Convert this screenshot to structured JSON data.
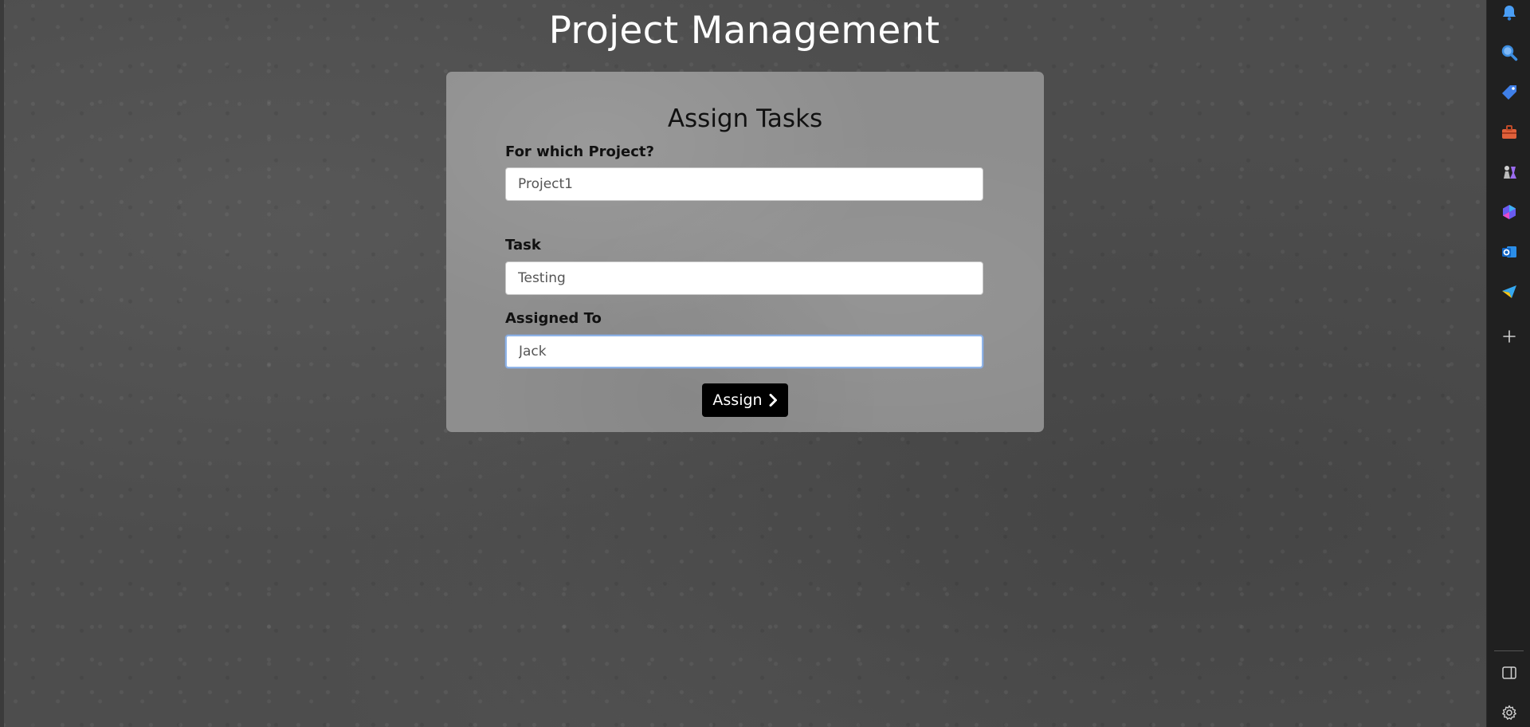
{
  "page": {
    "title": "Project Management"
  },
  "form": {
    "heading": "Assign Tasks",
    "project_label": "For which Project?",
    "project_value": "Project1",
    "task_label": "Task",
    "task_value": "Testing",
    "assigned_label": "Assigned To",
    "assigned_value": "Jack",
    "submit_label": "Assign",
    "submit_icon": "chevron-right-icon"
  },
  "sidebar": {
    "icons": [
      "bell-icon",
      "search-icon",
      "tag-icon",
      "toolbox-icon",
      "chess-icon",
      "copilot-icon",
      "outlook-icon",
      "send-icon",
      "add-icon"
    ],
    "bottom_icons": [
      "sidebar-toggle-icon",
      "settings-icon"
    ]
  },
  "colors": {
    "background": "#4d4d4d",
    "card": "#8e8e8e",
    "button": "#000000",
    "focus_border": "#8fb4e8",
    "sidebar": "#202020"
  }
}
